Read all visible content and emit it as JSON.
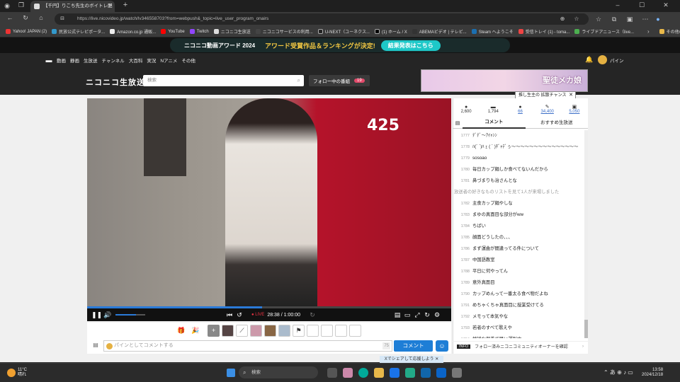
{
  "browser": {
    "tab_title": "【千円】りこち先生のボイトレ配",
    "url": "https://live.nicovideo.jp/watch/lv346558703?from=webpush&_topic=live_user_program_onairs",
    "bookmarks": [
      "Yahoo! JAPAN (2)",
      "民放公式テレビポータ...",
      "Amazon.co.jp 通販...",
      "YouTube",
      "Twitch",
      "ニコニコ生放送",
      "ニコニコサービスの利用...",
      "U-NEXT（ユーネクス...",
      "(1) ホーム / X",
      "ABEMAビデオ | テレビ...",
      "Steam へようこそ",
      "受信トレイ (1) - toma...",
      "ライブドアニュース（live..."
    ],
    "other_bookmarks": "その他のお気に入り"
  },
  "site": {
    "banner_title": "ニコニコ動画アワード 2024",
    "banner_text": "アワード受賞作品＆ランキングが決定!",
    "banner_button": "結果発表はこちら",
    "nav": [
      "動画",
      "静画",
      "生放送",
      "チャンネル",
      "大百科",
      "実況",
      "Nアニメ",
      "その他"
    ],
    "user_name": "パイン",
    "logo": "ニコニコ生放送",
    "search_placeholder": "検索",
    "follow_label": "フォロー中の番組",
    "follow_count": "19",
    "ad_text": "聖徒メカ娘",
    "tooltip": "推し生主の 拡散チャンス"
  },
  "player": {
    "door_number": "425",
    "live_label": "LIVE",
    "time": "28:38 / 1:00:00",
    "progress_pct": 0.48,
    "volume_pct": 0.7
  },
  "comment_input": {
    "placeholder": "パインとしてコメントする",
    "char_count": "75",
    "submit": "コメント"
  },
  "x_share": "Xでシェアして応援しよう",
  "stats": [
    {
      "icon": "person-icon",
      "value": "2,600"
    },
    {
      "icon": "comment-icon",
      "value": "1,794"
    },
    {
      "icon": "ad-icon",
      "value": "66"
    },
    {
      "icon": "gift-icon",
      "value": "34,400"
    },
    {
      "icon": "gift-box-icon",
      "value": "5,050"
    }
  ],
  "tabs": [
    "コメント",
    "おすすめ生放送"
  ],
  "comments": [
    {
      "n": "1777",
      "t": "ﾃﾞﾃﾞ〜ｱｲｬﾝﾝ"
    },
    {
      "n": "1778",
      "t": "ﾊ(´ `)ﾊ ｪ ( ´ )ﾁﾞｬﾃﾞぅ〜〜〜〜〜〜〜〜〜〜〜〜〜〜〜"
    },
    {
      "n": "1779",
      "t": "sosoao"
    },
    {
      "n": "1780",
      "t": "毎日カップ麺しか食べてないんだから"
    },
    {
      "n": "1781",
      "t": "鼻づまりも治さんとな"
    },
    {
      "n": "",
      "t": "放送者の好きなものリストを見て1人が来場しました",
      "sys": true
    },
    {
      "n": "1782",
      "t": "主食カップ麺やしな"
    },
    {
      "n": "1783",
      "t": "まゆの真面目な部分がww"
    },
    {
      "n": "1784",
      "t": "ちばい"
    },
    {
      "n": "1785",
      "t": "顔面どうしたの、、、"
    },
    {
      "n": "1786",
      "t": "まず運曲が間違ってる件について"
    },
    {
      "n": "1787",
      "t": "中国語教室"
    },
    {
      "n": "1788",
      "t": "平日に何やってん"
    },
    {
      "n": "1789",
      "t": "意外真面目"
    },
    {
      "n": "1790",
      "t": "カップめんって一番太る食べ物だよね"
    },
    {
      "n": "1791",
      "t": "めちゃくちゃ真面目に授業受けてる"
    },
    {
      "n": "1792",
      "t": "メモって本気やな"
    },
    {
      "n": "1793",
      "t": "若者のすべて歌えや"
    },
    {
      "n": "1794",
      "t": "地球な保養で踊い運別中"
    }
  ],
  "info_label": "INFO",
  "info_text": "フォロー済みニコニコミュニティオーナーを確認",
  "taskbar": {
    "weather_temp": "11°C",
    "weather_text": "晴れ",
    "search": "検索",
    "time": "13:58",
    "date": "2024/12/18"
  }
}
